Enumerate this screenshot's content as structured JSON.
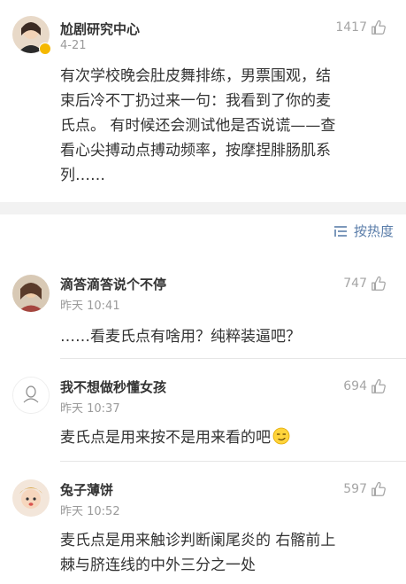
{
  "post": {
    "username": "尬剧研究中心",
    "timestamp": "4-21",
    "likes": "1417",
    "body_lines": [
      "有次学校晚会肚皮舞排练，男票围观，结",
      "束后冷不丁扔过来一句：我看到了你的麦",
      "氏点。 有时候还会测试他是否说谎——查",
      "看心尖搏动点搏动频率，按摩捏腓肠肌系",
      "列……"
    ]
  },
  "sort": {
    "label": "按热度",
    "icon": "sort-icon"
  },
  "comments": [
    {
      "username": "滴答滴答说个不停",
      "timestamp": "昨天 10:41",
      "likes": "747",
      "text_lines": [
        "……看麦氏点有啥用？纯粹装逼吧？"
      ]
    },
    {
      "username": "我不想做秒懂女孩",
      "timestamp": "昨天 10:37",
      "likes": "694",
      "text_lines": [
        "麦氏点是用来按不是用来看的吧"
      ],
      "emoji": "smirk-emoji"
    },
    {
      "username": "兔子薄饼",
      "timestamp": "昨天 10:52",
      "likes": "597",
      "text_lines": [
        "麦氏点是用来触诊判断阑尾炎的 右髂前上",
        "棘与脐连线的中外三分之一处"
      ]
    }
  ],
  "colors": {
    "accent": "#5b7eaa",
    "muted": "#9a9a9a",
    "text": "#333333",
    "divider": "#f2f2f2"
  }
}
